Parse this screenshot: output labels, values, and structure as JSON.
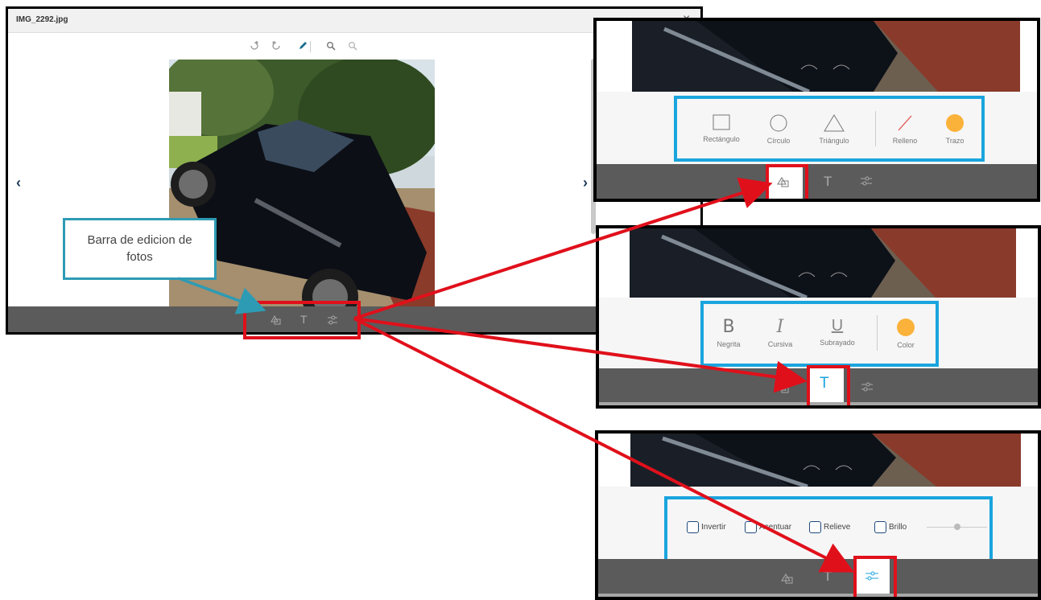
{
  "viewer": {
    "filename": "IMG_2292.jpg",
    "close_glyph": "×",
    "prev_glyph": "‹",
    "next_glyph": "›",
    "toolbar_icons": [
      "rotate-right-icon",
      "rotate-left-icon",
      "pencil-icon",
      "zoom-in-icon",
      "zoom-out-icon"
    ],
    "bottom_tools": [
      "shapes-icon",
      "text-icon",
      "adjust-icon"
    ]
  },
  "callout": {
    "text_line1": "Barra  de edicion de",
    "text_line2": "fotos"
  },
  "shapes_panel": {
    "tools": [
      {
        "label": "Rectángulo",
        "icon": "rectangle-icon"
      },
      {
        "label": "Círculo",
        "icon": "circle-icon"
      },
      {
        "label": "Triángulo",
        "icon": "triangle-icon"
      },
      {
        "label": "Relleno",
        "icon": "fill-line-icon"
      },
      {
        "label": "Trazo",
        "icon": "stroke-color-icon"
      }
    ],
    "active_tool": "shapes"
  },
  "text_panel": {
    "tools": [
      {
        "label": "Negrita",
        "glyph": "B"
      },
      {
        "label": "Cursiva",
        "glyph": "I"
      },
      {
        "label": "Subrayado",
        "glyph": "U"
      },
      {
        "label": "Color",
        "glyph": ""
      }
    ],
    "active_tool": "text"
  },
  "adjust_panel": {
    "options": [
      {
        "label": "Invertir",
        "checked": false
      },
      {
        "label": "Acentuar",
        "checked": false
      },
      {
        "label": "Relieve",
        "checked": false
      },
      {
        "label": "Brillo",
        "checked": false
      }
    ],
    "active_tool": "adjust"
  },
  "colors": {
    "accent_blue": "#1aa5de",
    "highlight_red": "#e0101b",
    "swatch_orange": "#fbb23a",
    "callout_border": "#2e9bb4",
    "bar_gray": "#5b5b5b"
  },
  "text_glyph": "T"
}
